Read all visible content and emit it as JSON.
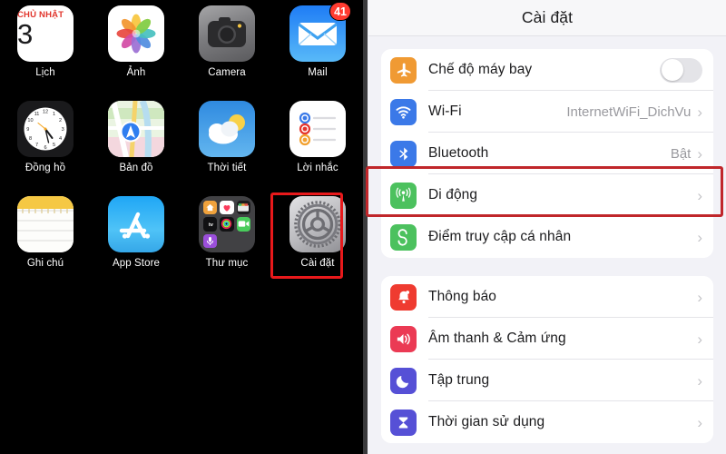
{
  "home_screen": {
    "apps": [
      {
        "name": "Lịch",
        "icon": "calendar-icon",
        "calendar_day": "CHỦ NHẬT",
        "calendar_date": "3"
      },
      {
        "name": "Ảnh",
        "icon": "photos-icon"
      },
      {
        "name": "Camera",
        "icon": "camera-icon"
      },
      {
        "name": "Mail",
        "icon": "mail-icon",
        "badge": "41"
      },
      {
        "name": "Đồng hồ",
        "icon": "clock-icon"
      },
      {
        "name": "Bản đồ",
        "icon": "maps-icon"
      },
      {
        "name": "Thời tiết",
        "icon": "weather-icon"
      },
      {
        "name": "Lời nhắc",
        "icon": "reminders-icon"
      },
      {
        "name": "Ghi chú",
        "icon": "notes-icon"
      },
      {
        "name": "App Store",
        "icon": "app-store-icon"
      },
      {
        "name": "Thư mục",
        "icon": "folder-icon"
      },
      {
        "name": "Cài đặt",
        "icon": "settings-gear-icon",
        "highlighted": true
      }
    ],
    "folder_mini_apps": [
      "home-icon",
      "health-icon",
      "wallet-icon",
      "apple-tv-icon",
      "fitness-icon",
      "facetime-icon",
      "podcasts-icon"
    ]
  },
  "settings": {
    "title": "Cài đặt",
    "group1": [
      {
        "label": "Chế độ máy bay",
        "icon": "airplane-icon",
        "icon_color": "#f09a33",
        "control": "toggle",
        "toggle_on": false
      },
      {
        "label": "Wi-Fi",
        "icon": "wifi-icon",
        "icon_color": "#3b79e8",
        "value": "InternetWiFi_DichVu",
        "chevron": "›"
      },
      {
        "label": "Bluetooth",
        "icon": "bluetooth-icon",
        "icon_color": "#3b79e8",
        "value": "Bật",
        "chevron": "›"
      },
      {
        "label": "Di động",
        "icon": "cellular-icon",
        "icon_color": "#4cc15e",
        "chevron": "›",
        "highlighted": true
      },
      {
        "label": "Điểm truy cập cá nhân",
        "icon": "hotspot-icon",
        "icon_color": "#4cc15e",
        "chevron": "›"
      }
    ],
    "group2": [
      {
        "label": "Thông báo",
        "icon": "bell-icon",
        "icon_color": "#ef3b30",
        "chevron": "›"
      },
      {
        "label": "Âm thanh & Cảm ứng",
        "icon": "speaker-icon",
        "icon_color": "#eb3a54",
        "chevron": "›"
      },
      {
        "label": "Tập trung",
        "icon": "moon-icon",
        "icon_color": "#5650d6",
        "chevron": "›"
      },
      {
        "label": "Thời gian sử dụng",
        "icon": "hourglass-icon",
        "icon_color": "#5650d6",
        "chevron": "›"
      }
    ]
  },
  "annotations": {
    "highlight_color": "#d4262a",
    "settings_app_highlight": "Cài đặt",
    "cellular_row_highlight": "Di động"
  }
}
